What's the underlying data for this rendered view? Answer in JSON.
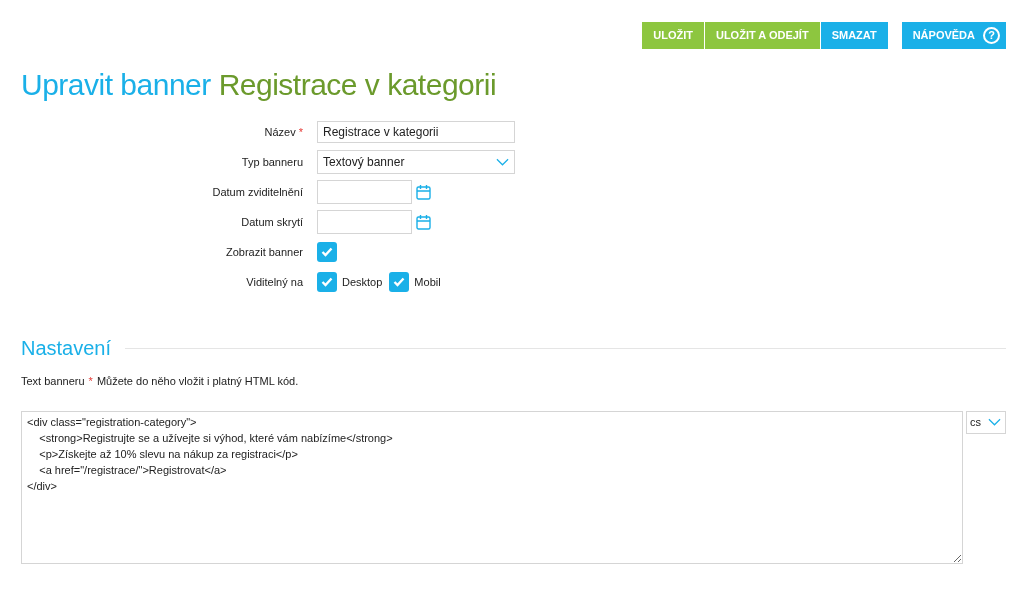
{
  "toolbar": {
    "buttons": [
      {
        "label": "ULOŽIT",
        "color": "#8dc63f"
      },
      {
        "label": "ULOŽIT A ODEJÍT",
        "color": "#8dc63f"
      },
      {
        "label": "SMAZAT",
        "color": "#1ab0e8"
      }
    ],
    "help": {
      "label": "NÁPOVĚDA",
      "icon": "?"
    }
  },
  "title": {
    "prefix": "Upravit banner",
    "name": "Registrace v kategorii"
  },
  "fields": [
    {
      "kind": "text",
      "label": "Název",
      "required_mark": "*",
      "value": "Registrace v kategorii"
    },
    {
      "kind": "select",
      "label": "Typ banneru",
      "value": "Textový banner"
    },
    {
      "kind": "date",
      "label": "Datum zviditelnění"
    },
    {
      "kind": "date",
      "label": "Datum skrytí"
    },
    {
      "kind": "checkbox",
      "label": "Zobrazit banner",
      "checked": true
    },
    {
      "kind": "checkboxes",
      "label": "Viditelný na",
      "options": [
        {
          "label": "Desktop",
          "checked": true
        },
        {
          "label": "Mobil",
          "checked": true
        }
      ]
    }
  ],
  "section": {
    "title": "Nastavení",
    "field_label": "Text banneru",
    "required_mark": "*",
    "hint": "Můžete do něho vložit i platný HTML kód.",
    "code_lines": [
      "<div class=\"registration-category\">",
      "\t<strong>Registrujte se a užívejte si výhod, které vám nabízíme</strong>",
      "\t<p>Získejte až 10% slevu na nákup za registraci</p>",
      "\t<a href=\"/registrace/\">Registrovat</a>",
      "</div>"
    ],
    "language": "cs"
  }
}
